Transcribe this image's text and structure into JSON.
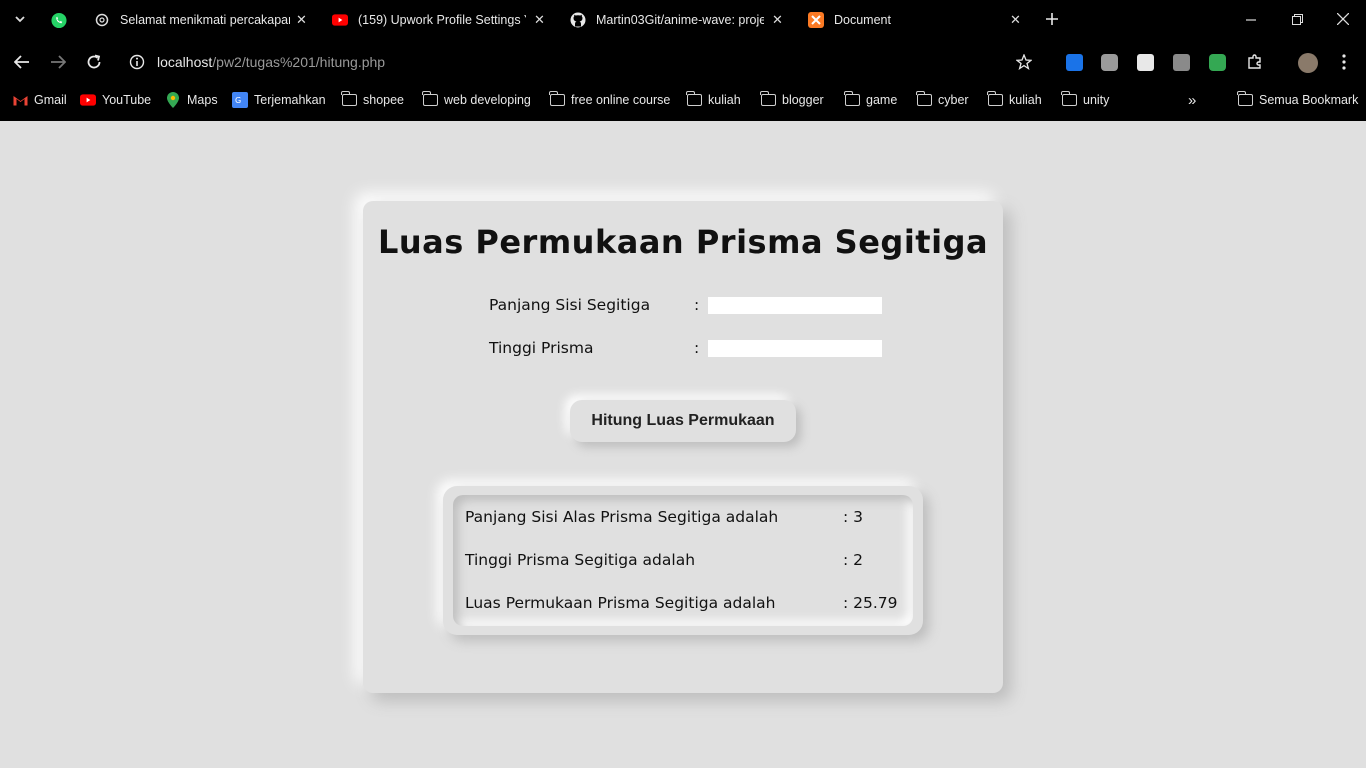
{
  "browser": {
    "tabs": [
      {
        "title": "Selamat menikmati percakapan",
        "icon": "chatgpt-icon"
      },
      {
        "title": "(159) Upwork Profile Settings Yo",
        "icon": "youtube-icon"
      },
      {
        "title": "Martin03Git/anime-wave: proje",
        "icon": "github-icon"
      },
      {
        "title": "Document",
        "icon": "xampp-icon"
      }
    ],
    "url_host": "localhost",
    "url_path": "/pw2/tugas%201/hitung.php",
    "bookmarks": [
      "Gmail",
      "YouTube",
      "Maps",
      "Terjemahkan",
      "shopee",
      "web developing",
      "free online course",
      "kuliah",
      "blogger",
      "game",
      "cyber",
      "kuliah",
      "unity"
    ],
    "all_bookmarks": "Semua Bookmark",
    "more": "»"
  },
  "page": {
    "title": "Luas Permukaan Prisma Segitiga",
    "fields": [
      {
        "label": "Panjang Sisi Segitiga",
        "colon": ":",
        "value": ""
      },
      {
        "label": "Tinggi Prisma",
        "colon": ":",
        "value": ""
      }
    ],
    "button_label": "Hitung Luas Permukaan",
    "results": [
      {
        "label": "Panjang Sisi Alas Prisma Segitiga adalah",
        "value": ": 3"
      },
      {
        "label": "Tinggi Prisma Segitiga adalah",
        "value": ": 2"
      },
      {
        "label": "Luas Permukaan Prisma Segitiga adalah",
        "value": ": 25.79"
      }
    ]
  },
  "colors": {
    "background": "#e0e0e0",
    "chrome": "#000000"
  }
}
